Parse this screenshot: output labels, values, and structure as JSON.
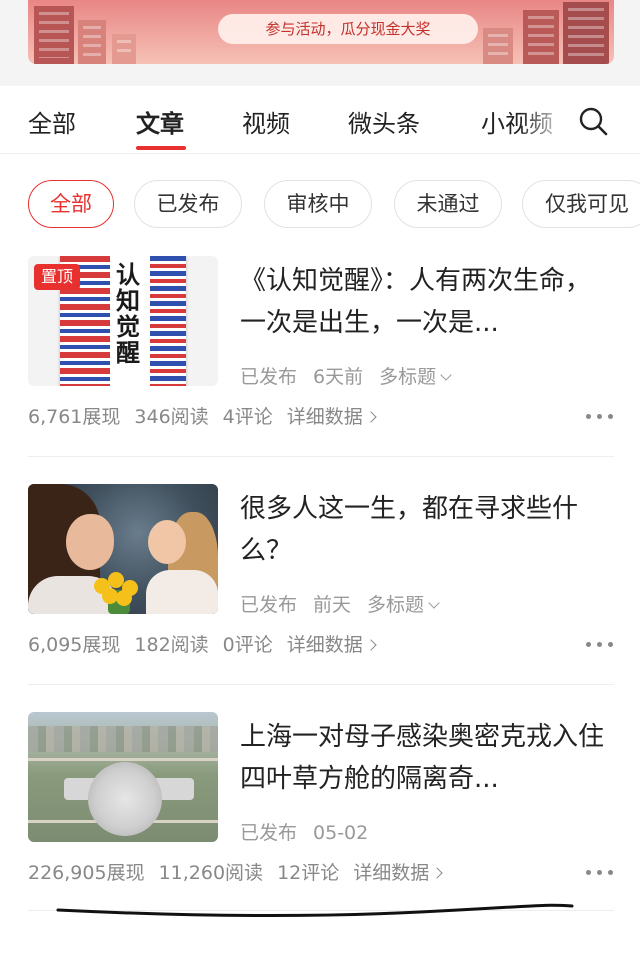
{
  "banner": {
    "text": "参与活动，瓜分现金大奖"
  },
  "tabs": [
    {
      "label": "全部"
    },
    {
      "label": "文章"
    },
    {
      "label": "视频"
    },
    {
      "label": "微头条"
    },
    {
      "label": "小视频"
    }
  ],
  "active_tab": "文章",
  "filters": [
    {
      "label": "全部"
    },
    {
      "label": "已发布"
    },
    {
      "label": "审核中"
    },
    {
      "label": "未通过"
    },
    {
      "label": "仅我可见"
    }
  ],
  "active_filter": "全部",
  "articles": [
    {
      "pinned_label": "置顶",
      "cover_text": "认知觉醒",
      "title": "《认知觉醒》：人有两次生命，一次是出生，一次是...",
      "status": "已发布",
      "time": "6天前",
      "multi_title": "多标题",
      "impressions": "6,761展现",
      "reads": "346阅读",
      "comments": "4评论",
      "details": "详细数据"
    },
    {
      "title": "很多人这一生，都在寻求些什么？",
      "status": "已发布",
      "time": "前天",
      "multi_title": "多标题",
      "impressions": "6,095展现",
      "reads": "182阅读",
      "comments": "0评论",
      "details": "详细数据"
    },
    {
      "title": "上海一对母子感染奥密克戎入住四叶草方舱的隔离奇...",
      "status": "已发布",
      "time": "05-02",
      "impressions": "226,905展现",
      "reads": "11,260阅读",
      "comments": "12评论",
      "details": "详细数据"
    }
  ],
  "colors": {
    "accent": "#e8302f",
    "text": "#222222",
    "muted": "#999999"
  }
}
